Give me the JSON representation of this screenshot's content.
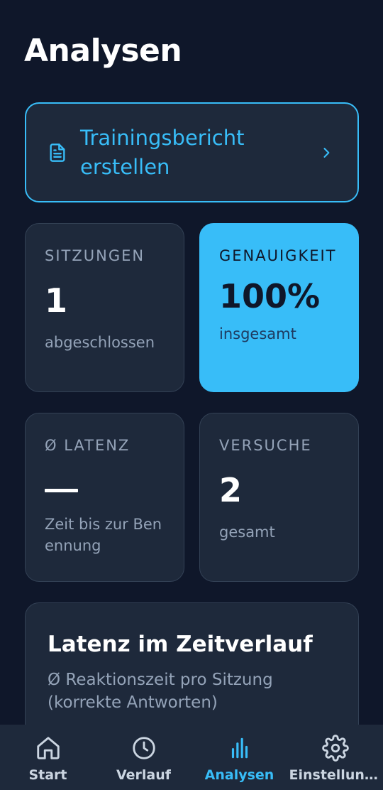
{
  "page_title": "Analysen",
  "report_button": {
    "label": "Trainingsbericht erstellen",
    "icon": "document-icon"
  },
  "stats": [
    {
      "label": "SITZUNGEN",
      "value": "1",
      "sub": "abgeschlossen"
    },
    {
      "label": "GENAUIGKEIT",
      "value": "100%",
      "sub": "insgesamt"
    },
    {
      "label": "Ø LATENZ",
      "value": "—",
      "sub": "Zeit bis zur Benennung"
    },
    {
      "label": "VERSUCHE",
      "value": "2",
      "sub": "gesamt"
    }
  ],
  "latency_chart": {
    "title": "Latenz im Zeitverlauf",
    "description": "Ø Reaktionszeit pro Sitzung (korrekte Antworten)"
  },
  "tabs": [
    {
      "label": "Start",
      "icon": "home-icon",
      "active": false
    },
    {
      "label": "Verlauf",
      "icon": "clock-icon",
      "active": false
    },
    {
      "label": "Analysen",
      "icon": "bar-chart-icon",
      "active": true
    },
    {
      "label": "Einstellungen",
      "icon": "gear-icon",
      "active": false
    }
  ],
  "colors": {
    "accent": "#38bdf8",
    "background": "#0f172a",
    "card": "#1e293b"
  }
}
